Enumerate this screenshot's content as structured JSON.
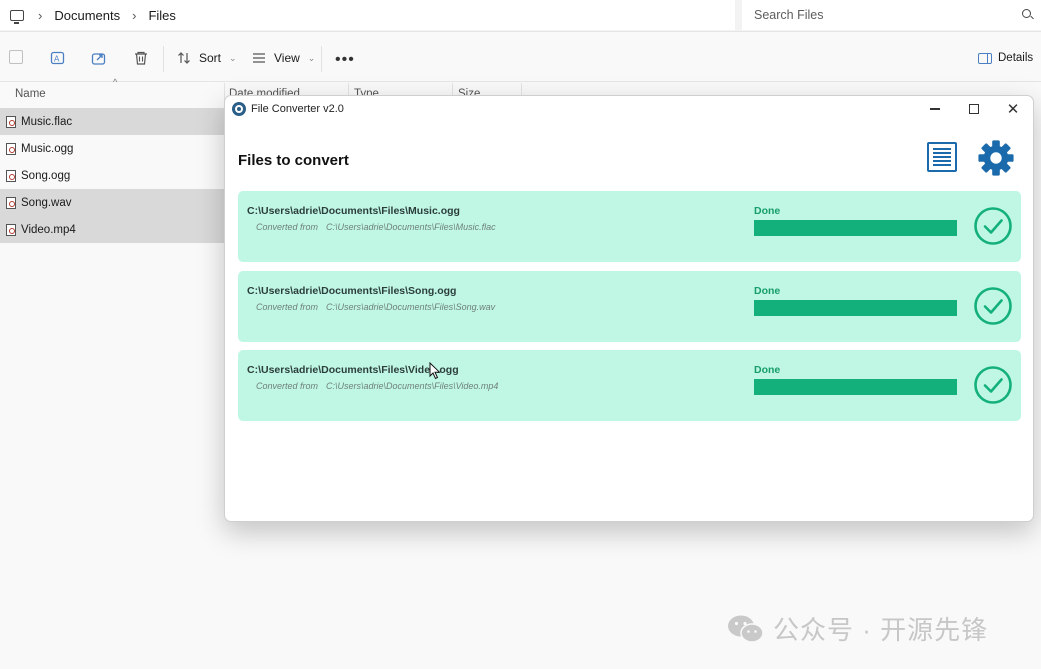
{
  "explorer": {
    "breadcrumb": [
      "Documents",
      "Files"
    ],
    "search_placeholder": "Search Files",
    "toolbar": {
      "sort_label": "Sort",
      "view_label": "View",
      "more_label": "•••",
      "details_label": "Details"
    },
    "columns": [
      "Name",
      "Date modified",
      "Type",
      "Size"
    ],
    "files": [
      {
        "name": "Music.flac",
        "selected": true
      },
      {
        "name": "Music.ogg",
        "selected": false
      },
      {
        "name": "Song.ogg",
        "selected": false
      },
      {
        "name": "Song.wav",
        "selected": true
      },
      {
        "name": "Video.mp4",
        "selected": true
      }
    ]
  },
  "converter": {
    "window_title": "File Converter v2.0",
    "heading": "Files to convert",
    "converted_from_label": "Converted from",
    "items": [
      {
        "output": "C:\\Users\\adrie\\Documents\\Files\\Music.ogg",
        "source": "C:\\Users\\adrie\\Documents\\Files\\Music.flac",
        "status": "Done",
        "progress": 1.0
      },
      {
        "output": "C:\\Users\\adrie\\Documents\\Files\\Song.ogg",
        "source": "C:\\Users\\adrie\\Documents\\Files\\Song.wav",
        "status": "Done",
        "progress": 1.0
      },
      {
        "output": "C:\\Users\\adrie\\Documents\\Files\\Video.ogg",
        "source": "C:\\Users\\adrie\\Documents\\Files\\Video.mp4",
        "status": "Done",
        "progress": 1.0
      }
    ],
    "colors": {
      "accent": "#1b6aab",
      "card_bg": "#bff7e4",
      "success": "#13b07c"
    }
  },
  "watermark": {
    "text": "公众号 · 开源先锋"
  },
  "icons": [
    "computer-icon",
    "chevron-right-icon",
    "search-icon",
    "copy-icon",
    "rename-icon",
    "share-icon",
    "delete-icon",
    "sort-icon",
    "view-icon",
    "more-icon",
    "details-pane-icon",
    "audio-file-icon",
    "app-logo-icon",
    "minimize-icon",
    "maximize-icon",
    "close-icon",
    "list-icon",
    "gear-icon",
    "checkmark-circle-icon",
    "wechat-icon"
  ]
}
